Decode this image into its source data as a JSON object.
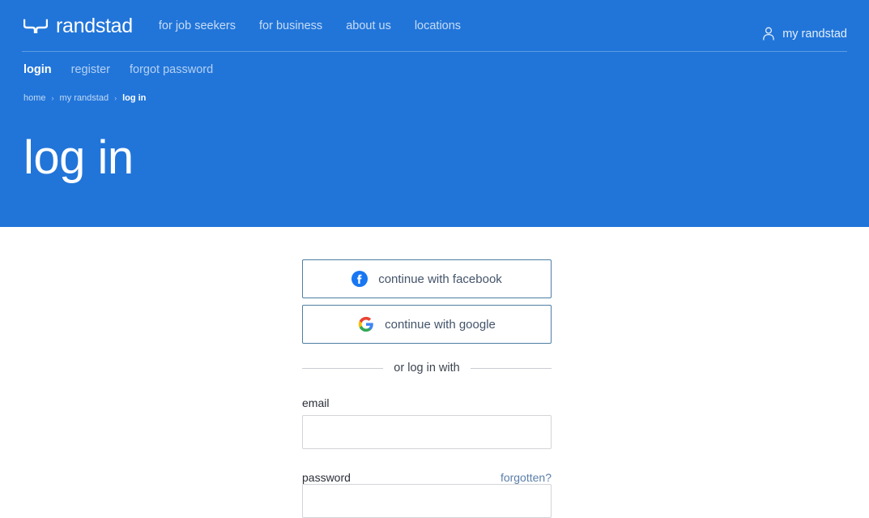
{
  "brand": {
    "name": "randstad",
    "mark_icon": "randstad-twin-arrow-icon",
    "hero_color": "#2175d9"
  },
  "header": {
    "nav": [
      {
        "label": "for job seekers"
      },
      {
        "label": "for business"
      },
      {
        "label": "about us"
      },
      {
        "label": "locations"
      }
    ],
    "account": {
      "label": "my randstad",
      "icon": "person-icon"
    }
  },
  "subnav": {
    "items": [
      {
        "label": "login",
        "active": true
      },
      {
        "label": "register",
        "active": false
      },
      {
        "label": "forgot password",
        "active": false
      }
    ]
  },
  "breadcrumb": {
    "items": [
      {
        "label": "home"
      },
      {
        "label": "my randstad"
      },
      {
        "label": "log in"
      }
    ],
    "separator": "›"
  },
  "page": {
    "title": "log in"
  },
  "form": {
    "facebook_button": {
      "label": "continue with facebook",
      "icon": "facebook-icon",
      "icon_color": "#1877f2"
    },
    "google_button": {
      "label": "continue with google",
      "icon": "google-icon"
    },
    "divider_text": "or log in with",
    "email": {
      "label": "email",
      "value": "",
      "placeholder": ""
    },
    "password": {
      "label": "password",
      "value": "",
      "placeholder": "",
      "forgot_link": "forgotten?"
    }
  },
  "colors": {
    "hero_blue": "#2175d9",
    "button_border": "#4d7ea3",
    "link_blue": "#5b7fa8",
    "input_border": "#d2d4d8"
  }
}
